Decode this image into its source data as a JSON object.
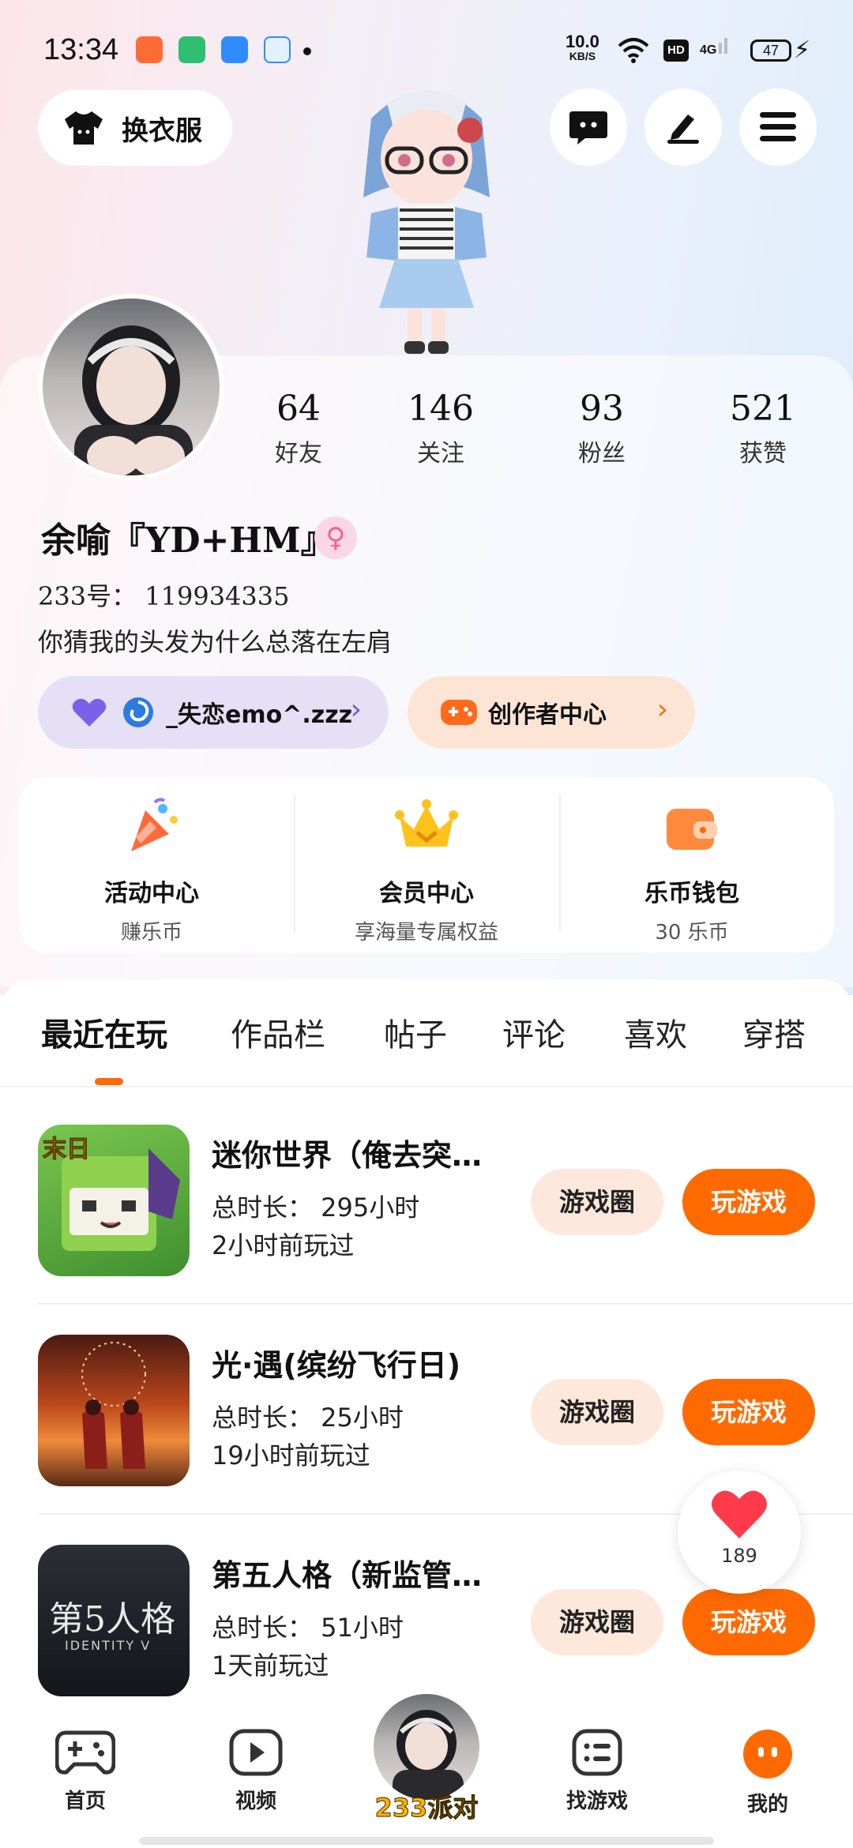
{
  "status_bar": {
    "time": "13:34",
    "net_speed": "10.0",
    "net_unit": "KB/S",
    "hd": "HD",
    "signal": "4G",
    "battery": "47"
  },
  "header": {
    "outfit_label": "换衣服",
    "icons": [
      "chat-icon",
      "edit-icon",
      "menu-icon"
    ]
  },
  "profile": {
    "stats": [
      {
        "num": "64",
        "label": "好友"
      },
      {
        "num": "146",
        "label": "关注"
      },
      {
        "num": "93",
        "label": "粉丝"
      },
      {
        "num": "521",
        "label": "获赞"
      }
    ],
    "nickname": "余喻『YD+HM』",
    "gender_symbol": "♀",
    "uid": "233号： 119934335",
    "bio": "你猜我的头发为什么总落在左肩",
    "fan_pill": "_失恋emo^.zzz",
    "creator_pill": "创作者中心"
  },
  "services": [
    {
      "title": "活动中心",
      "sub": "赚乐币"
    },
    {
      "title": "会员中心",
      "sub": "享海量专属权益"
    },
    {
      "title": "乐币钱包",
      "sub": "30 乐币"
    }
  ],
  "tabs": [
    "最近在玩",
    "作品栏",
    "帖子",
    "评论",
    "喜欢",
    "穿搭"
  ],
  "games": [
    {
      "title": "迷你世界（俺去突…",
      "duration": "总时长： 295小时",
      "last": "2小时前玩过",
      "circle_btn": "游戏圈",
      "play_btn": "玩游戏"
    },
    {
      "title": "光·遇(缤纷飞行日)",
      "duration": "总时长： 25小时",
      "last": "19小时前玩过",
      "circle_btn": "游戏圈",
      "play_btn": "玩游戏"
    },
    {
      "title": "第五人格（新监管…",
      "duration": "总时长： 51小时",
      "last": "1天前玩过",
      "circle_btn": "游戏圈",
      "play_btn": "玩游戏"
    }
  ],
  "game_thumb_text": {
    "mini": "末日",
    "identity": "第5人格",
    "identity_sub": "IDENTITY V"
  },
  "likes_fab": {
    "count": "189"
  },
  "bottom_nav": {
    "home": "首页",
    "video": "视频",
    "party": "233派对",
    "find": "找游戏",
    "mine": "我的"
  },
  "colors": {
    "accent": "#ff6a00",
    "circle_btn_bg": "#fde8db",
    "fan_pill_bg": "#e6e0f6",
    "creator_pill_bg": "#fde5d6"
  }
}
